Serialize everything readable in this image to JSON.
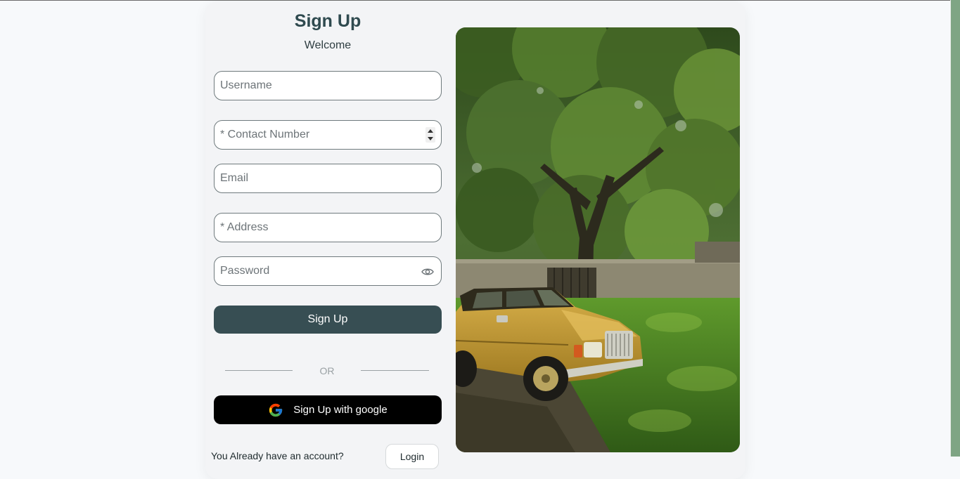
{
  "form": {
    "title": "Sign Up",
    "subtitle": "Welcome",
    "username_placeholder": "Username",
    "contact_placeholder": "* Contact Number",
    "email_placeholder": "Email",
    "address_placeholder": "* Address",
    "password_placeholder": "Password",
    "submit_label": "Sign Up",
    "or_label": "OR",
    "google_label": "Sign Up with google",
    "already_text": "You Already have an account?",
    "login_label": "Login"
  },
  "colors": {
    "primary_button": "#374e53",
    "google_button": "#000000",
    "card_background": "#f3f4f6",
    "title_color": "#2f4a4f"
  },
  "icons": {
    "password_toggle": "eye-icon",
    "google": "google-g-icon",
    "number_spinner": "spinner-arrows-icon"
  },
  "image": {
    "subject": "yellow vintage car parked under a large tree on grass"
  }
}
